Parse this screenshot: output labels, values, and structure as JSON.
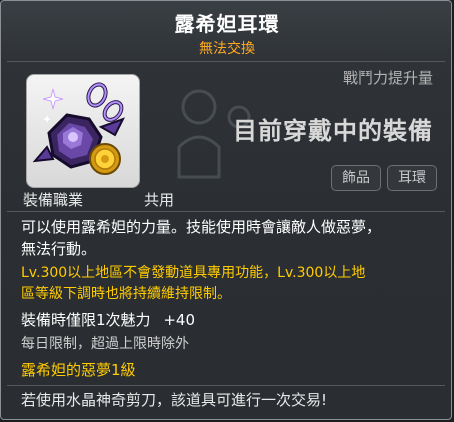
{
  "item": {
    "name": "露希妲耳環",
    "trade_status": "無法交換",
    "icon": "earring-icon"
  },
  "stats_panel": {
    "power_label": "戰鬥力提升量",
    "equipped_text": "目前穿戴中的裝備"
  },
  "tags": [
    "飾品",
    "耳環"
  ],
  "job": {
    "label": "裝備職業",
    "value": "共用"
  },
  "description": {
    "line1": "可以使用露希妲的力量。技能使用時會讓敵人做惡夢，",
    "line2": "無法行動。",
    "yellow1": "Lv.300以上地區不會發動道具專用功能，Lv.300以上地",
    "yellow2": "區等級下調時也將持續維持限制。"
  },
  "limits": {
    "limit_label": "裝備時僅限1次魅力",
    "limit_value": "+40",
    "daily": "每日限制，超過上限時除外"
  },
  "set": {
    "title": "露希妲的惡夢1級"
  },
  "footer": {
    "text": "若使用水晶神奇剪刀，該道具可進行一次交易!"
  },
  "colors": {
    "trade": "#ffaa22",
    "highlight": "#ffcc00",
    "background": "#2b2f33"
  }
}
